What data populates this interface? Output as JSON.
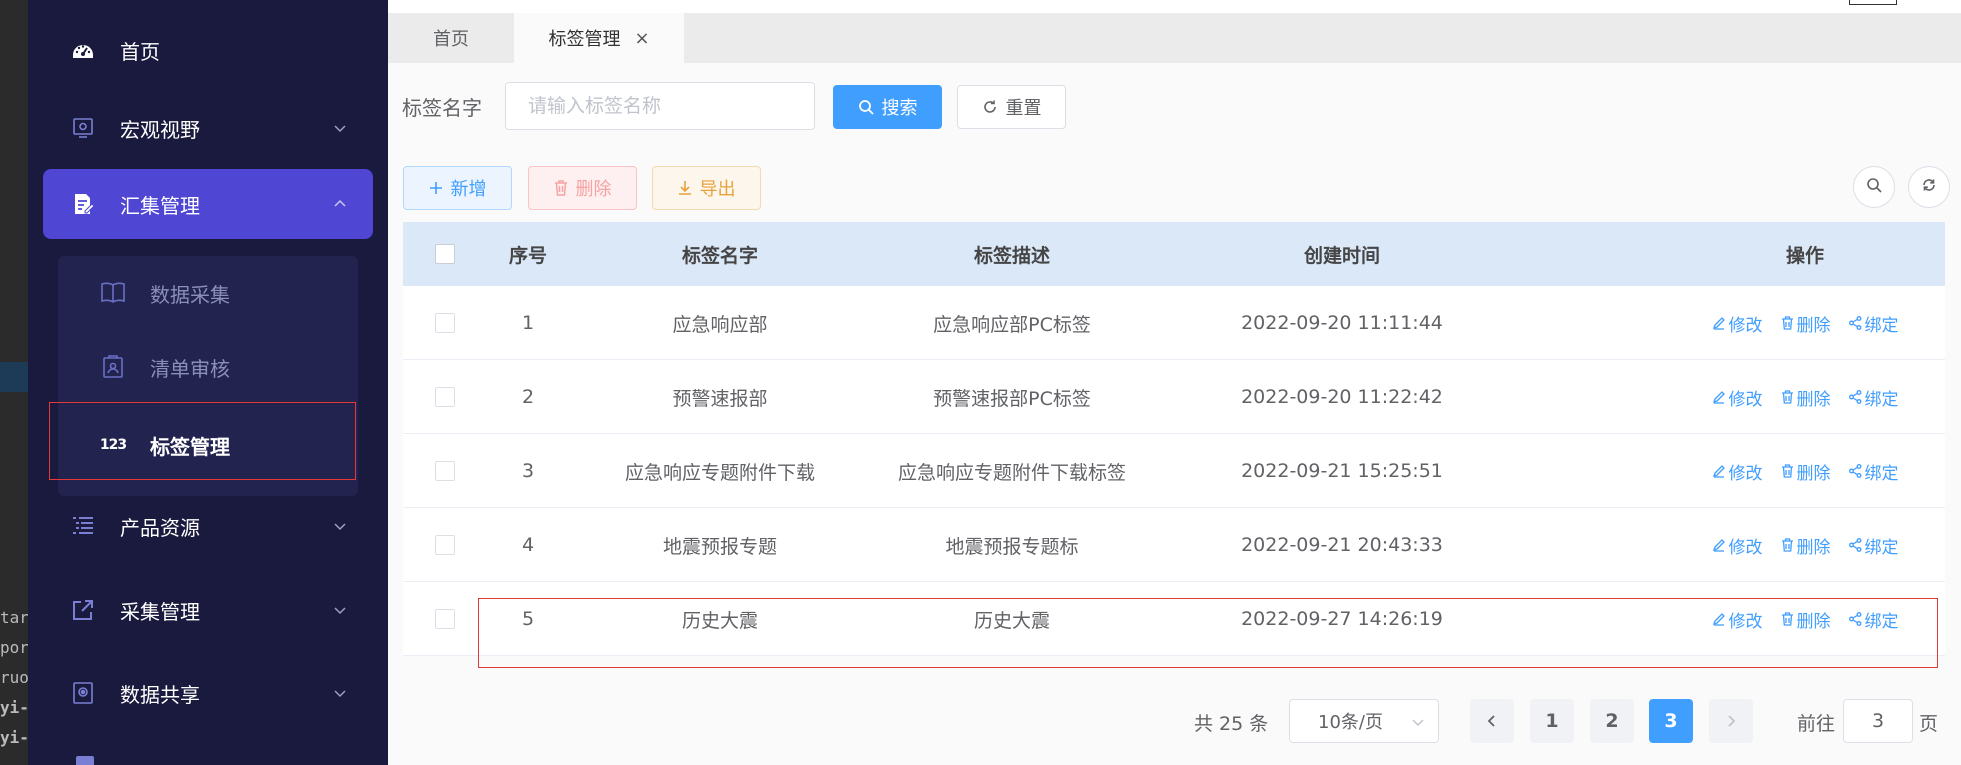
{
  "sidebar": {
    "items": [
      {
        "label": "首页",
        "icon": "dashboard-icon"
      },
      {
        "label": "宏观视野",
        "icon": "monitor-icon"
      },
      {
        "label": "汇集管理",
        "icon": "document-edit-icon",
        "active": true,
        "expanded": true
      },
      {
        "label": "产品资源",
        "icon": "list-icon"
      },
      {
        "label": "采集管理",
        "icon": "external-link-icon"
      },
      {
        "label": "数据共享",
        "icon": "share-box-icon"
      }
    ],
    "submenu": [
      {
        "label": "数据采集",
        "icon": "book-icon"
      },
      {
        "label": "清单审核",
        "icon": "checklist-icon"
      },
      {
        "label": "标签管理",
        "icon": "number-123-icon",
        "active": true
      }
    ]
  },
  "tabs": [
    {
      "label": "首页"
    },
    {
      "label": "标签管理",
      "closable": true,
      "active": true
    }
  ],
  "search": {
    "label": "标签名字",
    "placeholder": "请输入标签名称",
    "value": "",
    "search_button": "搜索",
    "reset_button": "重置"
  },
  "toolbar": {
    "add": "新增",
    "delete": "删除",
    "export": "导出"
  },
  "table": {
    "columns": [
      "序号",
      "标签名字",
      "标签描述",
      "创建时间",
      "操作"
    ],
    "rows": [
      {
        "index": "1",
        "name": "应急响应部",
        "desc": "应急响应部PC标签",
        "time": "2022-09-20 11:11:44"
      },
      {
        "index": "2",
        "name": "预警速报部",
        "desc": "预警速报部PC标签",
        "time": "2022-09-20 11:22:42"
      },
      {
        "index": "3",
        "name": "应急响应专题附件下载",
        "desc": "应急响应专题附件下载标签",
        "time": "2022-09-21 15:25:51"
      },
      {
        "index": "4",
        "name": "地震预报专题",
        "desc": "地震预报专题标",
        "time": "2022-09-21 20:43:33"
      },
      {
        "index": "5",
        "name": "历史大震",
        "desc": "历史大震",
        "time": "2022-09-27 14:26:19"
      }
    ],
    "actions": {
      "edit": "修改",
      "delete": "删除",
      "bind": "绑定"
    }
  },
  "pagination": {
    "total": "共 25 条",
    "page_size": "10条/页",
    "pages": [
      "1",
      "2",
      "3"
    ],
    "current": "3",
    "goto_label": "前往",
    "goto_value": "3",
    "page_suffix": "页"
  },
  "editor_fragments": [
    "targ",
    "por",
    "ruo",
    "yi-",
    "yi-"
  ],
  "colors": {
    "sidebar_bg": "#1a1a3e",
    "menu_active": "#4f46d3",
    "primary": "#409eff",
    "danger_outline": "#e53935"
  }
}
